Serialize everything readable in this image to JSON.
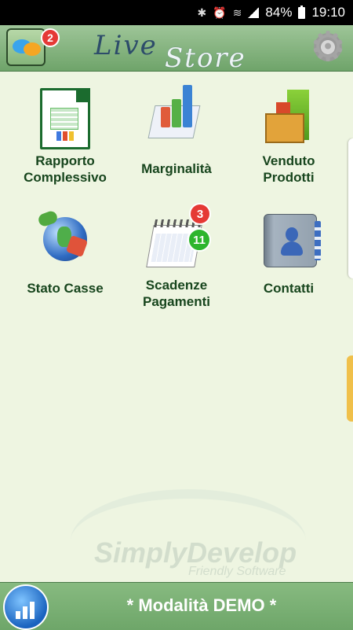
{
  "status_bar": {
    "battery": "84%",
    "time": "19:10"
  },
  "app_bar": {
    "logo_line1": "Live",
    "logo_line2": "Store",
    "chat_badge": "2",
    "icons": {
      "chat": "chat-bubbles-icon",
      "settings": "gear-icon"
    }
  },
  "tiles": [
    {
      "label_line1": "Rapporto",
      "label_line2": "Complessivo",
      "icon": "spreadsheet-document-icon"
    },
    {
      "label_line1": "Marginalità",
      "label_line2": "",
      "icon": "bar-chart-icon"
    },
    {
      "label_line1": "Venduto",
      "label_line2": "Prodotti",
      "icon": "products-crate-icon"
    },
    {
      "label_line1": "Stato Casse",
      "label_line2": "",
      "icon": "globe-arrows-icon"
    },
    {
      "label_line1": "Scadenze",
      "label_line2": "Pagamenti",
      "icon": "calendar-icon",
      "badge_red": "3",
      "badge_green": "11"
    },
    {
      "label_line1": "Contatti",
      "label_line2": "",
      "icon": "address-book-icon"
    }
  ],
  "watermark": {
    "title": "SimplyDevelop",
    "subtitle": "Friendly Software"
  },
  "footer": {
    "text": "* Modalità DEMO *",
    "icon": "cloud-chart-icon"
  },
  "colors": {
    "app_bar_green": "#7db277",
    "label_green": "#17451d",
    "background": "#eef5e1"
  }
}
